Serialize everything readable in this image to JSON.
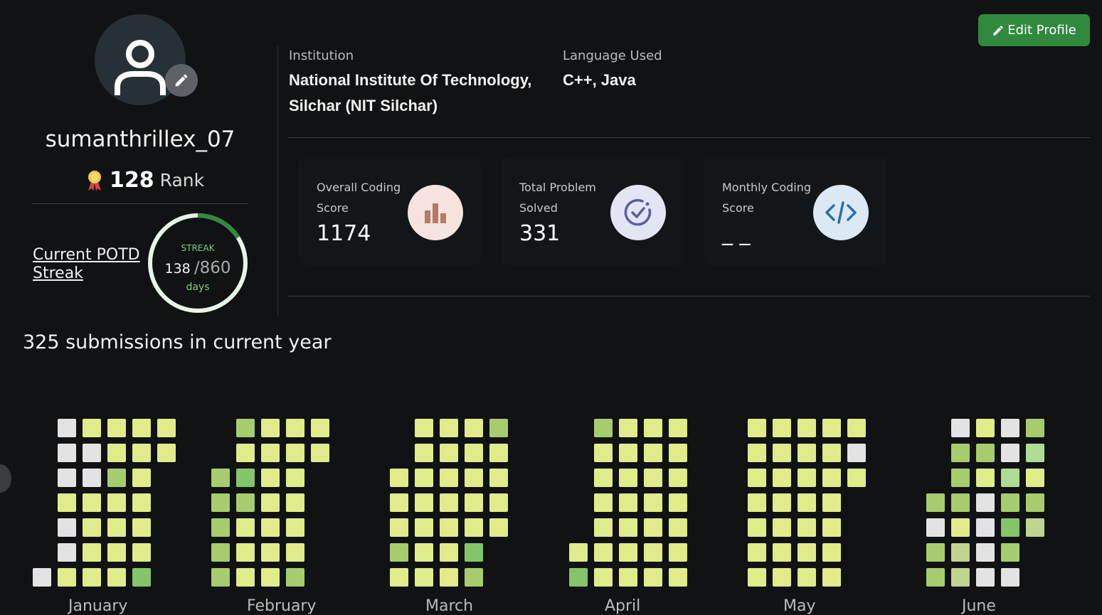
{
  "profile": {
    "username": "sumanthrillex_07",
    "rank_value": "128",
    "rank_label": "Rank",
    "avatar_icon": "user-icon",
    "edit_avatar_icon": "pencil-icon"
  },
  "potd": {
    "link_text": "Current POTD Streak",
    "streak_label": "STREAK",
    "current": "138",
    "total": "/860",
    "unit": "days",
    "progress": 0.16
  },
  "info": {
    "institution_label": "Institution",
    "institution_value": "National Institute Of Technology, Silchar (NIT Silchar)",
    "language_label": "Language Used",
    "language_value": "C++, Java"
  },
  "edit_button": {
    "label": "Edit Profile",
    "icon": "pencil-icon",
    "color": "#2f8a3e"
  },
  "stats": [
    {
      "label": "Overall Coding Score",
      "value": "1174",
      "icon": "bar-chart-icon",
      "circle_color": "#f5e3dd",
      "icon_color": "#b57a66"
    },
    {
      "label": "Total Problem Solved",
      "value": "331",
      "icon": "check-circle-icon",
      "circle_color": "#e3e5f5",
      "icon_color": "#5a5fa3"
    },
    {
      "label": "Monthly Coding Score",
      "value": "_ _",
      "icon": "code-icon",
      "circle_color": "#dce9f5",
      "icon_color": "#2e6ea5"
    }
  ],
  "submissions": {
    "title": "325 submissions in current year",
    "months": [
      "January",
      "February",
      "March",
      "April",
      "May",
      "June"
    ],
    "colors": {
      "empty": "#e3e3e3",
      "light": "#e0eb8a",
      "medium": "#a7cc6d",
      "dark": "#84c56a",
      "pale": "#aedc93",
      "sage": "#c1d38f"
    }
  }
}
